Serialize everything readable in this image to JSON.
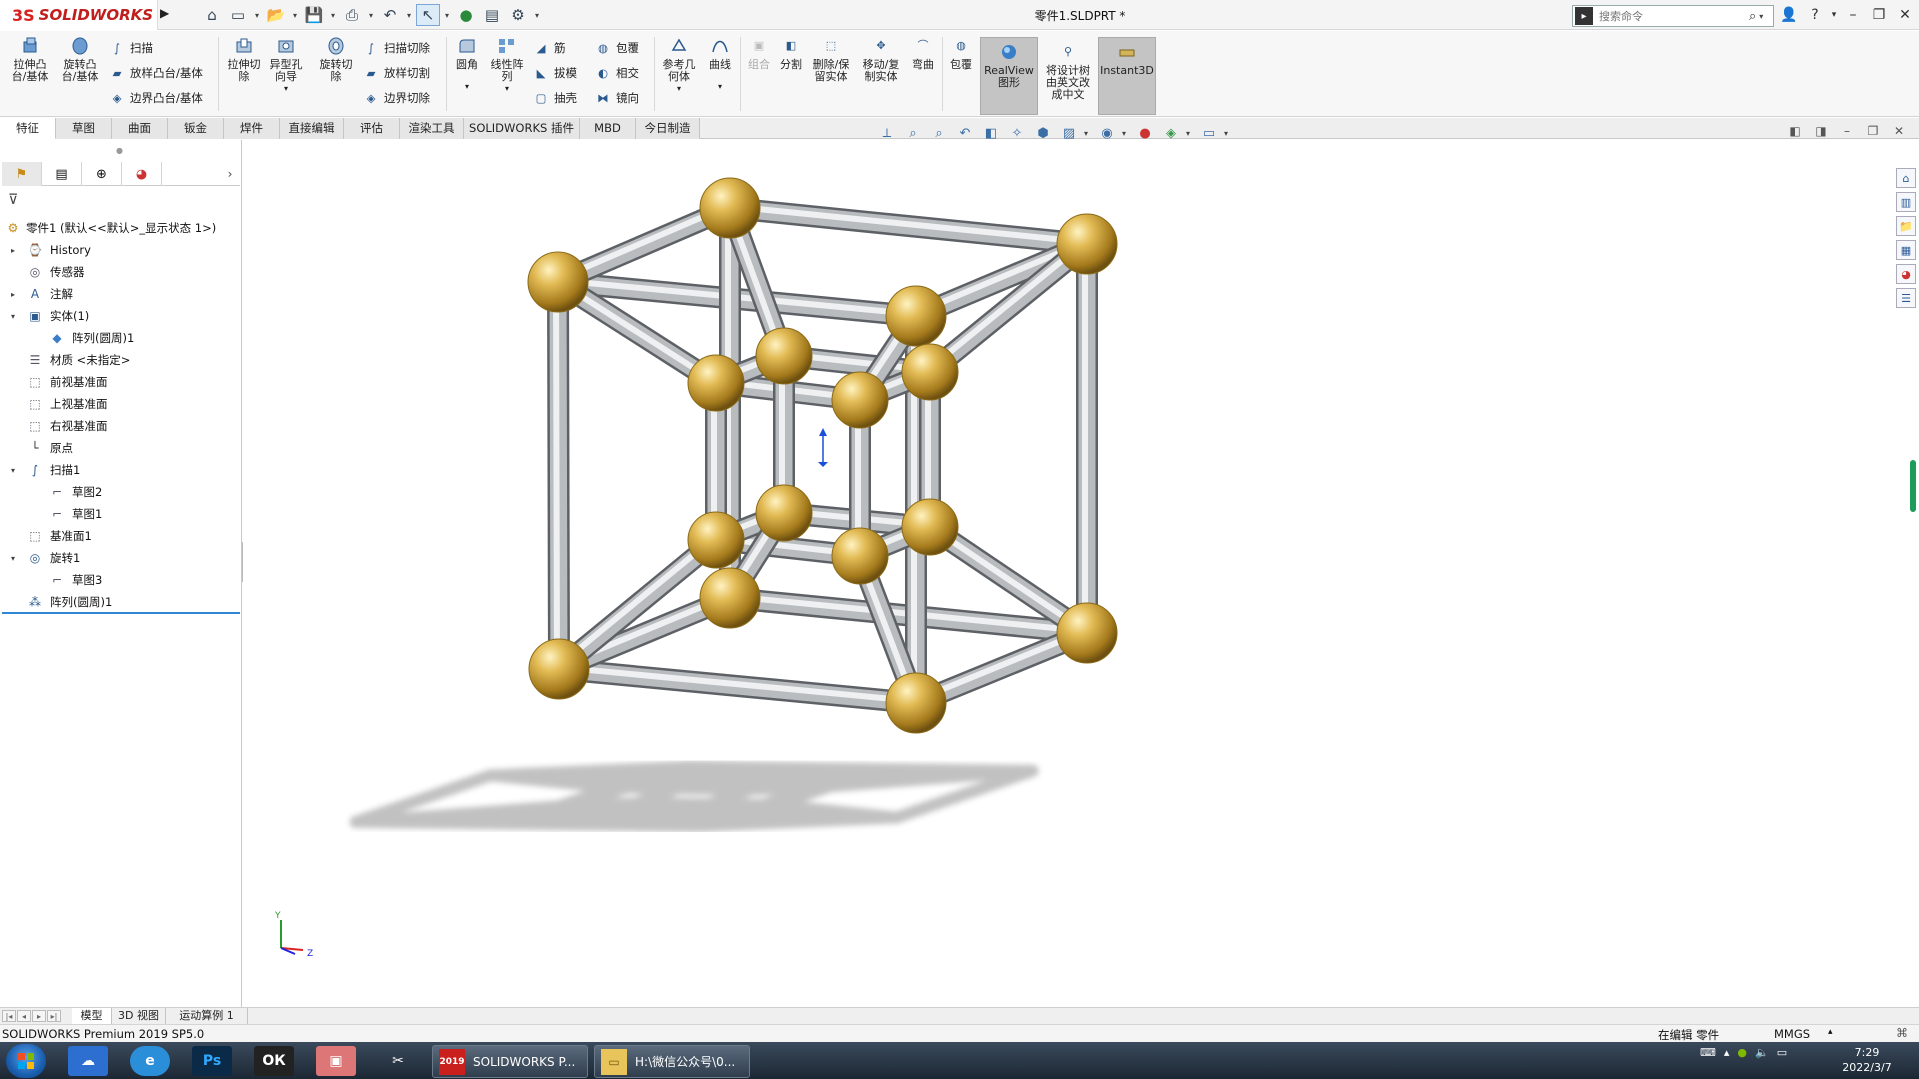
{
  "titlebar": {
    "brand_ds": "3S",
    "brand_name": "SOLIDWORKS",
    "document_title": "零件1.SLDPRT *",
    "search_placeholder": "搜索命令"
  },
  "ribbon": {
    "extrude_boss": "拉伸凸\n台/基体",
    "revolve_boss": "旋转凸\n台/基体",
    "sweep": "扫描",
    "loft_boss": "放样凸台/基体",
    "boundary_boss": "边界凸台/基体",
    "extrude_cut": "拉伸切\n除",
    "hole_wizard": "异型孔\n向导",
    "revolve_cut": "旋转切\n除",
    "sweep_cut": "扫描切除",
    "loft_cut": "放样切割",
    "boundary_cut": "边界切除",
    "fillet": "圆角",
    "linear_pattern": "线性阵\n列",
    "rib": "筋",
    "draft": "拔模",
    "shell": "抽壳",
    "wrap": "包覆",
    "intersect": "相交",
    "mirror": "镜向",
    "ref_geometry": "参考几\n何体",
    "curves": "曲线",
    "combine": "组合",
    "split": "分割",
    "delete_keep_body": "删除/保\n留实体",
    "move_copy_body": "移动/复\n制实体",
    "flex": "弯曲",
    "wrap2": "包覆",
    "realview": "RealView\n图形",
    "translate_tree": "将设计树\n由英文改\n成中文",
    "instant3d": "Instant3D"
  },
  "tabs": [
    "特征",
    "草图",
    "曲面",
    "钣金",
    "焊件",
    "直接编辑",
    "评估",
    "渲染工具",
    "SOLIDWORKS 插件",
    "MBD",
    "今日制造"
  ],
  "tree": {
    "root": "零件1 (默认<<默认>_显示状态 1>)",
    "items": [
      "History",
      "传感器",
      "注解",
      "实体(1)",
      "阵列(圆周)1",
      "材质 <未指定>",
      "前视基准面",
      "上视基准面",
      "右视基准面",
      "原点",
      "扫描1",
      "草图2",
      "草图1",
      "基准面1",
      "旋转1",
      "草图3",
      "阵列(圆周)1"
    ]
  },
  "bottom_tabs": [
    "模型",
    "3D 视图",
    "运动算例 1"
  ],
  "status": {
    "product": "SOLIDWORKS Premium 2019 SP5.0",
    "mode": "在编辑 零件",
    "units": "MMGS"
  },
  "taskbar": {
    "sw_task_label": "SOLIDWORKS P...",
    "sw_task_badge": "2019",
    "folder_task_label": "H:\\微信公众号\\0...",
    "time": "7:29",
    "date": "2022/3/7"
  },
  "axis": {
    "y": "Y",
    "z": "Z"
  },
  "colors": {
    "accent": "#2e86d4",
    "brand_red": "#d8201d",
    "node_gold": "#d4a83a",
    "bar_steel": "#b9bcbf"
  }
}
